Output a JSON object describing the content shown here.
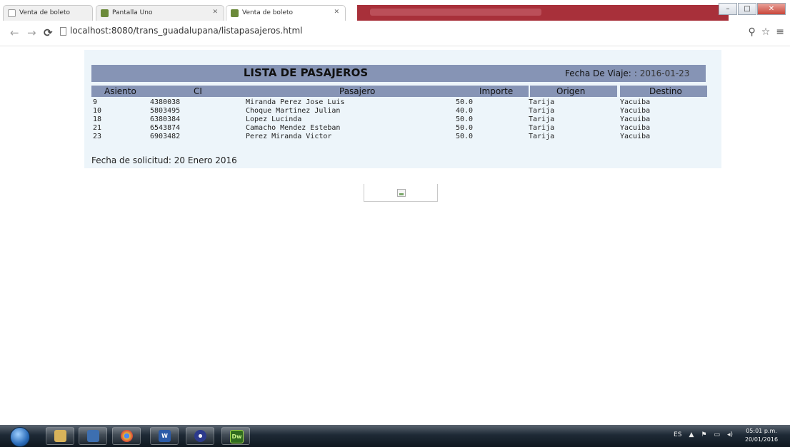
{
  "browser": {
    "tabs": [
      {
        "label": "Venta de boleto",
        "favicon": "page-icon"
      },
      {
        "label": "Pantalla Uno",
        "favicon": "dreamweaver-icon"
      },
      {
        "label": "Venta de boleto",
        "favicon": "dreamweaver-icon"
      }
    ],
    "url": "localhost:8080/trans_guadalupana/listapasajeros.html",
    "window_controls": {
      "minimize": "–",
      "maximize": "□",
      "close": "✕"
    }
  },
  "page": {
    "title": "LISTA DE PASAJEROS",
    "fecha_viaje_label": "Fecha De Viaje:",
    "fecha_viaje_value": ": 2016-01-23",
    "columns": [
      "Asiento",
      "CI",
      "Pasajero",
      "Importe",
      "Origen",
      "Destino"
    ],
    "rows": [
      {
        "asiento": "9",
        "ci": "4380038",
        "pasajero": "Miranda Perez Jose Luis",
        "importe": "50.0",
        "origen": "Tarija",
        "destino": "Yacuiba"
      },
      {
        "asiento": "10",
        "ci": "5803495",
        "pasajero": "Choque Martinez Julian",
        "importe": "40.0",
        "origen": "Tarija",
        "destino": "Yacuiba"
      },
      {
        "asiento": "18",
        "ci": "6380384",
        "pasajero": "Lopez Lucinda",
        "importe": "50.0",
        "origen": "Tarija",
        "destino": "Yacuiba"
      },
      {
        "asiento": "21",
        "ci": "6543874",
        "pasajero": "Camacho Mendez Esteban",
        "importe": "50.0",
        "origen": "Tarija",
        "destino": "Yacuiba"
      },
      {
        "asiento": "23",
        "ci": "6903482",
        "pasajero": "Perez Miranda Victor",
        "importe": "50.0",
        "origen": "Tarija",
        "destino": "Yacuiba"
      }
    ],
    "solicitud": "Fecha de solicitud: 20 Enero 2016"
  },
  "taskbar": {
    "apps": [
      "folder-icon",
      "media-player-icon",
      "chrome-icon",
      "word-icon",
      "eclipse-icon",
      "dreamweaver-icon"
    ],
    "dreamweaver_label": "Dw",
    "word_label": "W",
    "language": "ES",
    "time": "05:01 p.m.",
    "date": "20/01/2016"
  },
  "colors": {
    "header_bg": "#8694b5",
    "panel_bg": "#edf5fa",
    "tab_accent": "#a8303a"
  }
}
